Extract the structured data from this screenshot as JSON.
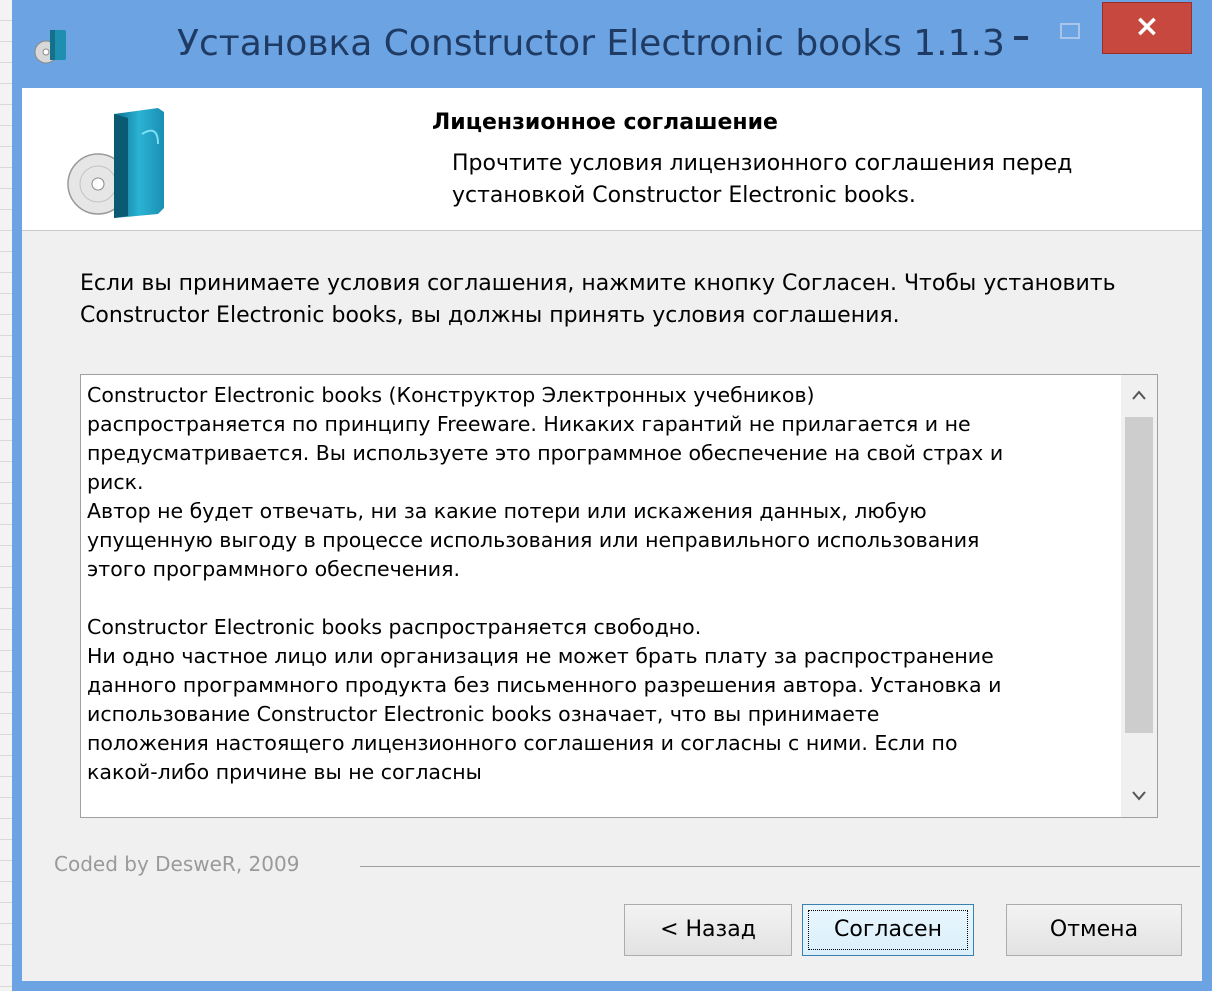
{
  "window": {
    "title": "Установка Constructor Electronic books 1.1.3",
    "close_glyph": "×"
  },
  "header": {
    "title": "Лицензионное соглашение",
    "subtitle": "Прочтите условия лицензионного соглашения перед установкой Constructor Electronic books."
  },
  "intro_text": "Если вы принимаете условия соглашения, нажмите кнопку Согласен. Чтобы установить Constructor Electronic books, вы должны принять условия соглашения.",
  "license": {
    "text": "Constructor Electronic books (Конструктор Электронных учебников)\nраспространяется по принципу Freeware. Никаких гарантий не прилагается и не\nпредусматривается. Вы используете это программное обеспечение на свой страх и\nриск.\nАвтор не будет отвечать, ни за какие потери или искажения данных, любую\nупущенную выгоду в процессе использования или неправильного использования\nэтого программного обеспечения.\n\nConstructor Electronic books распространяется свободно.\nНи одно частное лицо или организация не может брать плату за распространение\nданного программного продукта без письменного разрешения автора. Установка и\nиспользование Constructor Electronic books означает, что вы принимаете\nположения настоящего лицензионного соглашения и согласны с ними. Если по\nкакой-либо причине вы не согласны",
    "scroll_position": 0.0
  },
  "footer": {
    "coded_by": "Coded by DesweR, 2009"
  },
  "buttons": {
    "back": "< Назад",
    "agree": "Согласен",
    "cancel": "Отмена"
  },
  "colors": {
    "window_frame": "#6ba3e3",
    "close_button": "#c7483e"
  }
}
